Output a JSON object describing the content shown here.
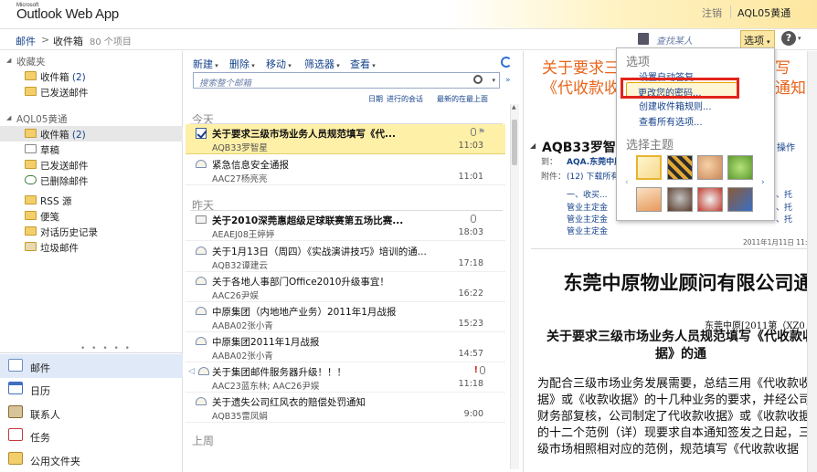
{
  "header": {
    "logo_small": "Microsoft",
    "logo_main": "Outlook Web App",
    "signout": "注销",
    "username": "AQL05黄通"
  },
  "breadcrumb": {
    "mail": "邮件",
    "sep": ">",
    "inbox": "收件箱",
    "count": "80 个项目"
  },
  "find_people": "查找某人",
  "options_label": "选项",
  "help_label": "?",
  "nav": {
    "favorites_label": "收藏夹",
    "favorites": [
      {
        "label": "收件箱",
        "count": "(2)"
      },
      {
        "label": "已发送邮件",
        "count": ""
      }
    ],
    "mailbox_label": "AQL05黄通",
    "folders": [
      {
        "label": "收件箱",
        "count": "(2)"
      },
      {
        "label": "草稿",
        "count": ""
      },
      {
        "label": "已发送邮件",
        "count": ""
      },
      {
        "label": "已删除邮件",
        "count": ""
      },
      {
        "label": "RSS 源",
        "count": ""
      },
      {
        "label": "便笺",
        "count": ""
      },
      {
        "label": "对话历史记录",
        "count": ""
      },
      {
        "label": "垃圾邮件",
        "count": ""
      }
    ],
    "dots": "• • • • •",
    "bottom": [
      {
        "label": "邮件",
        "icon": "mail-icon"
      },
      {
        "label": "日历",
        "icon": "calendar-icon"
      },
      {
        "label": "联系人",
        "icon": "contacts-icon"
      },
      {
        "label": "任务",
        "icon": "tasks-icon"
      },
      {
        "label": "公用文件夹",
        "icon": "public-folder-icon"
      }
    ]
  },
  "toolbar": {
    "new": "新建",
    "delete": "删除",
    "move": "移动",
    "filter": "筛选器",
    "view": "查看"
  },
  "search": {
    "placeholder": "搜索整个邮箱"
  },
  "arrange": {
    "date": "日期",
    "conv": "进行的会话",
    "newest": "最新的在最上面"
  },
  "groups": {
    "today": "今天",
    "yesterday": "昨天",
    "last_week": "上周"
  },
  "messages": [
    {
      "subject": "关于要求三级市场业务人员规范填写《代...",
      "from": "AQB33罗智星",
      "time": "11:03",
      "bold": true
    },
    {
      "subject": "紧急信息安全通报",
      "from": "AAC27杨亮亮",
      "time": "11:01",
      "bold": false
    },
    {
      "subject": "关于2010深莞惠超级足球联赛第五场比赛...",
      "from": "AEAEJ08王婷婷",
      "time": "18:03",
      "bold": true
    },
    {
      "subject": "关于1月13日（周四）《实战演讲技巧》培训的通...",
      "from": "AQB32谭建云",
      "time": "17:18",
      "bold": false
    },
    {
      "subject": "关于各地人事部门Office2010升级事宜！",
      "from": "AAC26尹娱",
      "time": "16:22",
      "bold": false
    },
    {
      "subject": "中原集团（内地地产业务）2011年1月战报",
      "from": "AABA02张小青",
      "time": "15:23",
      "bold": false
    },
    {
      "subject": "中原集团2011年1月战报",
      "from": "AABA02张小青",
      "time": "14:57",
      "bold": false
    },
    {
      "subject": "关于集团邮件服务器升级！！！",
      "from": "AAC23蓝东林; AAC26尹娱",
      "time": "11:18",
      "bold": false
    },
    {
      "subject": "关于遗失公司红风衣的赔偿处罚通知",
      "from": "AQB35雷凤娟",
      "time": "9:00",
      "bold": false
    }
  ],
  "reading": {
    "subject": "关于要求三级市场业务人员规范填写《代收款收据》或《收款收据》的通知",
    "from": "AQB33罗智星",
    "action": "操作",
    "to_label": "到：",
    "to": "AQA.东莞中原...",
    "att_label": "附件：",
    "att": "(12)  下载所有...",
    "links": [
      "一、收买...",
      "管业主定金",
      "管业主定金",
      "管业主定金"
    ],
    "side_links": [
      "、托",
      "、托",
      "、托"
    ],
    "date": "2011年1月11日 11:03",
    "company": "东莞中原物业顾问有限公司通",
    "docno": "东莞中原[2011第（XZ0",
    "doctitle": "关于要求三级市场业务人员规范填写《代收款收据》的通",
    "body": "为配合三级市场业务发展需要，总结三用《代收款收据》或《收款收据》的十几种业务的要求，并经公司财务部复核，公司制定了代收款收据》或《收款收据》的十二个范例（详）现要求自本通知签发之日起，三级市场相照相对应的范例，规范填写《代收款收据"
  },
  "popup": {
    "title": "选项",
    "items": [
      "设置自动答复...",
      "更改您的密码...",
      "创建收件箱规则...",
      "查看所有选项..."
    ],
    "theme_title": "选择主题",
    "themes": [
      "#fbe6a3",
      "#c99a2b",
      "#e4a27a",
      "#8fc46a",
      "#f3c6a0",
      "#9b5b3c",
      "#d84a3a",
      "#7aa35a",
      "#3e7fd0"
    ]
  }
}
